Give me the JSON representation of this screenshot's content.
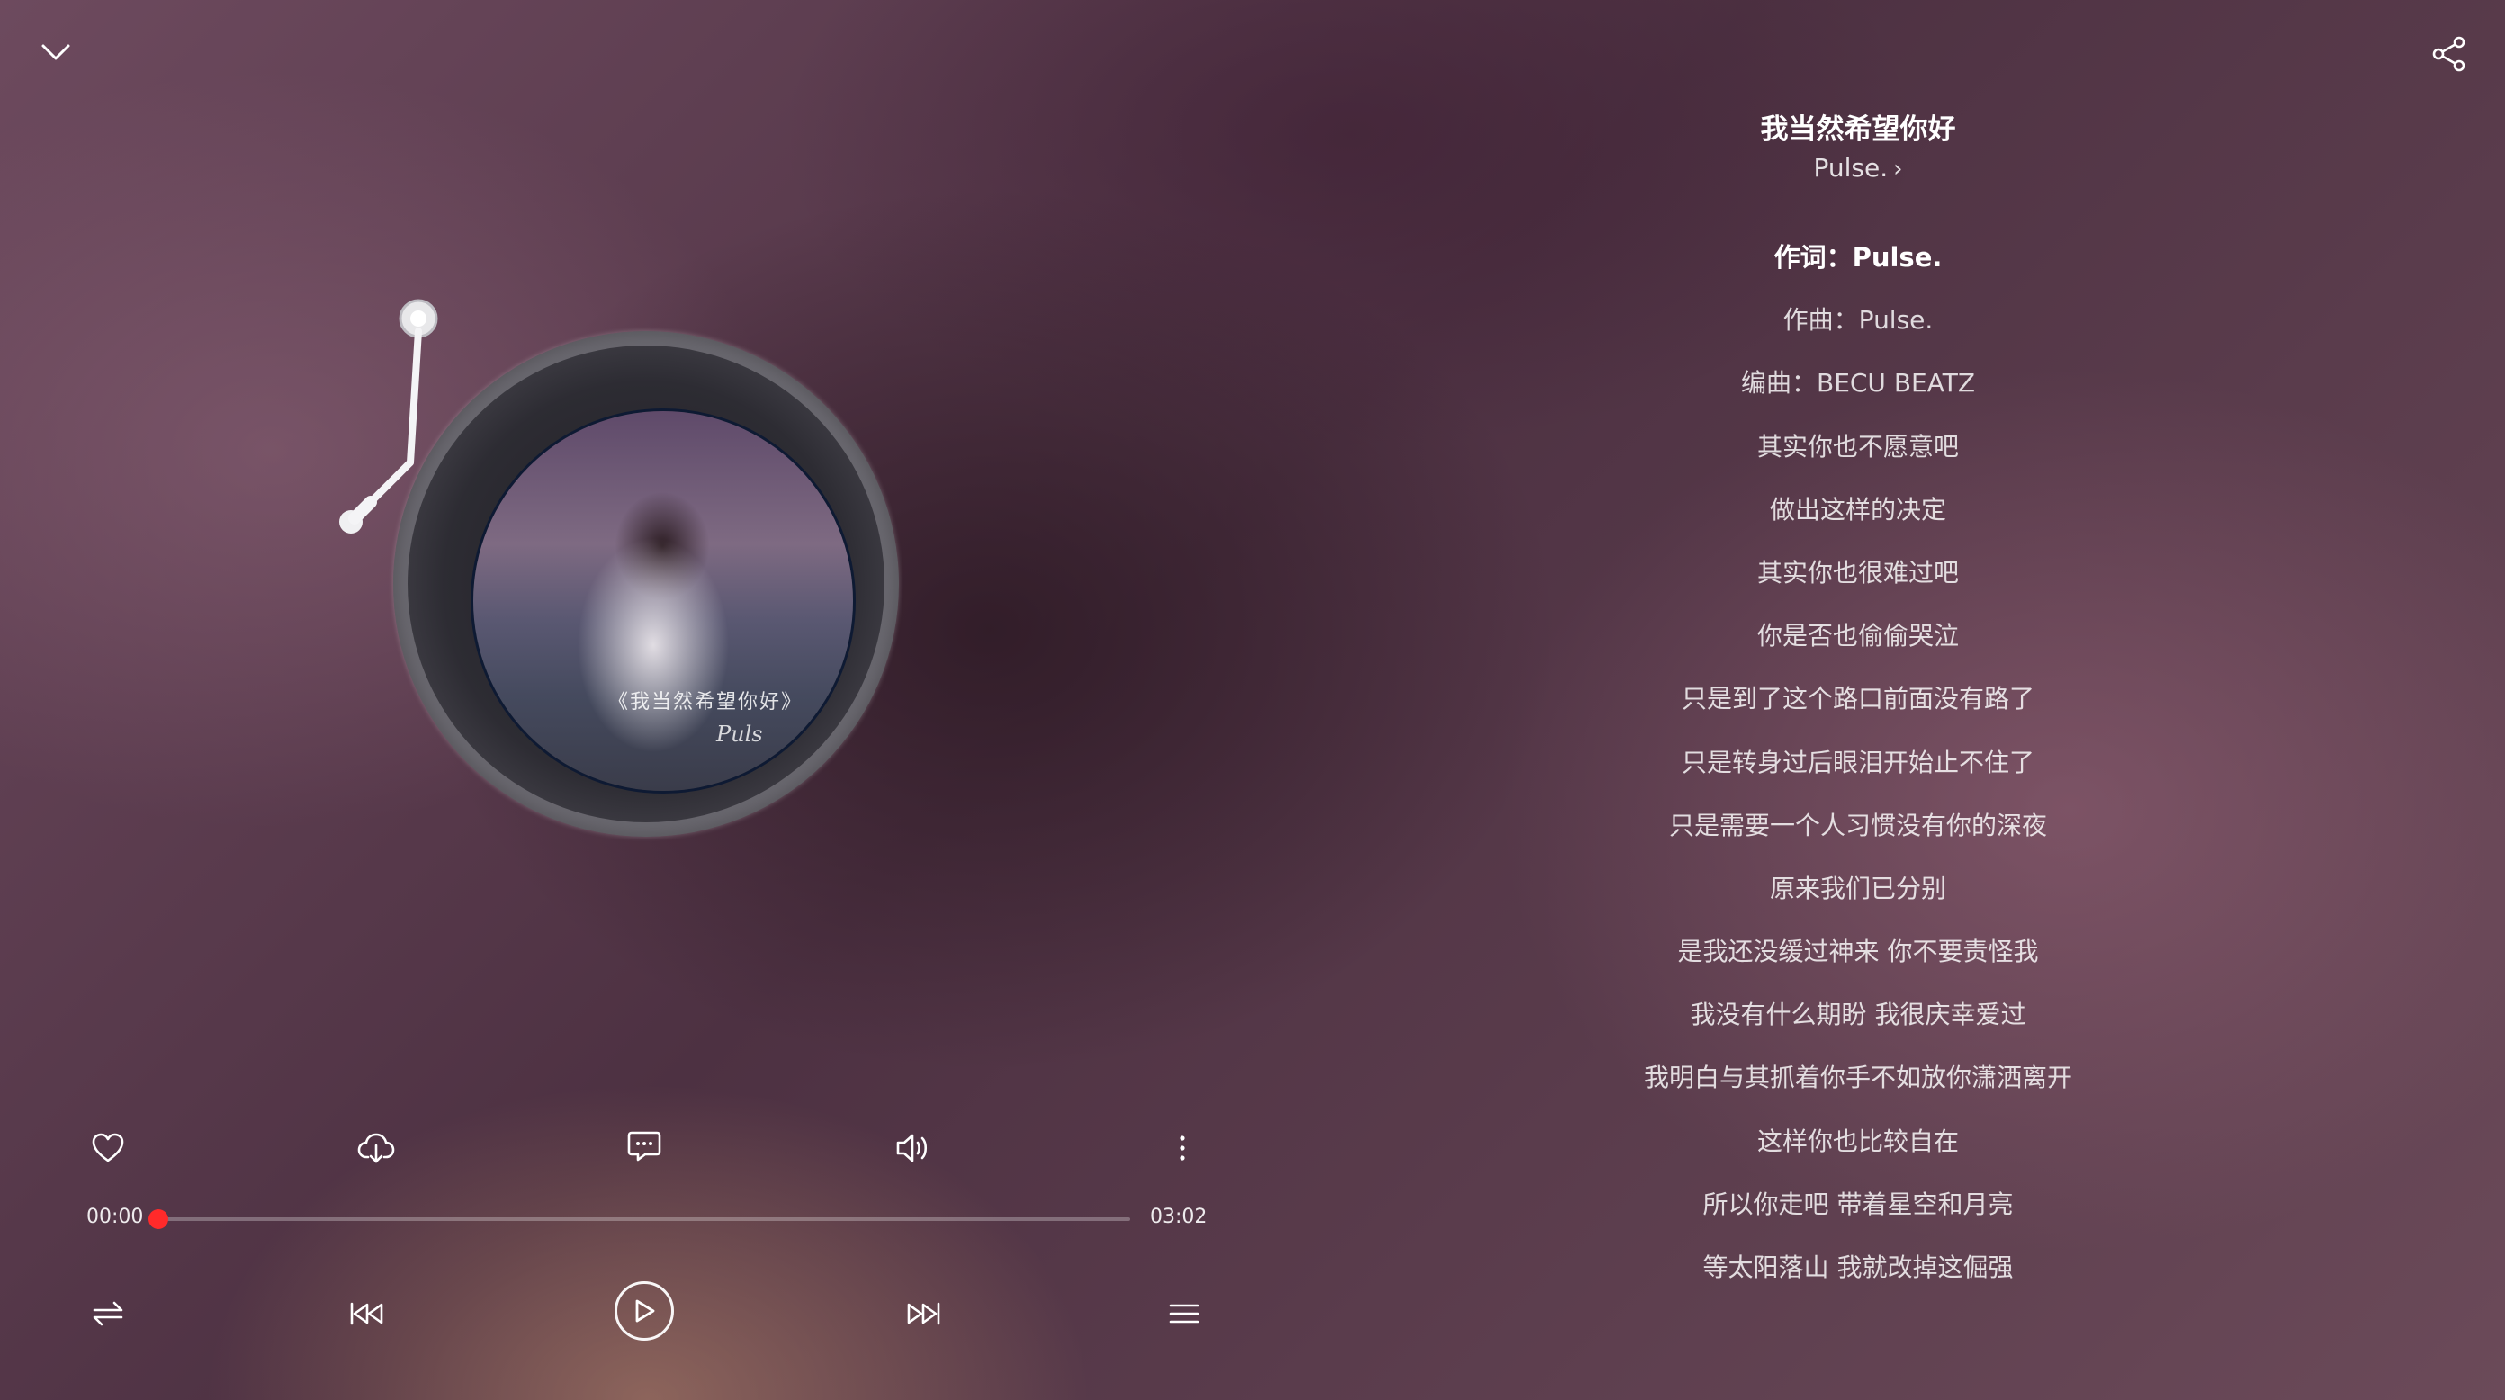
{
  "song": {
    "title": "我当然希望你好",
    "artist": "Pulse."
  },
  "cover": {
    "caption": "《我当然希望你好》",
    "signature": "Puls"
  },
  "lyrics": [
    "作词：Pulse.",
    "作曲：Pulse.",
    "编曲：BECU BEATZ",
    "其实你也不愿意吧",
    "做出这样的决定",
    "其实你也很难过吧",
    "你是否也偷偷哭泣",
    "只是到了这个路口前面没有路了",
    "只是转身过后眼泪开始止不住了",
    "只是需要一个人习惯没有你的深夜",
    "原来我们已分别",
    "是我还没缓过神来 你不要责怪我",
    "我没有什么期盼 我很庆幸爱过",
    "我明白与其抓着你手不如放你潇洒离开",
    "这样你也比较自在",
    "所以你走吧 带着星空和月亮",
    "等太阳落山 我就改掉这倔强"
  ],
  "active_lyric_index": 0,
  "playback": {
    "current_time": "00:00",
    "total_time": "03:02",
    "progress": 0.0,
    "state": "paused"
  },
  "colors": {
    "progress_accent": "#ff2a2a",
    "text_primary": "#ffffff"
  },
  "icons": {
    "top": [
      "chevron-down-icon",
      "share-icon"
    ],
    "actions": [
      "heart-icon",
      "download-icon",
      "comment-icon",
      "volume-icon",
      "more-icon"
    ],
    "transport": [
      "repeat-icon",
      "previous-icon",
      "play-icon",
      "next-icon",
      "playlist-icon"
    ]
  }
}
